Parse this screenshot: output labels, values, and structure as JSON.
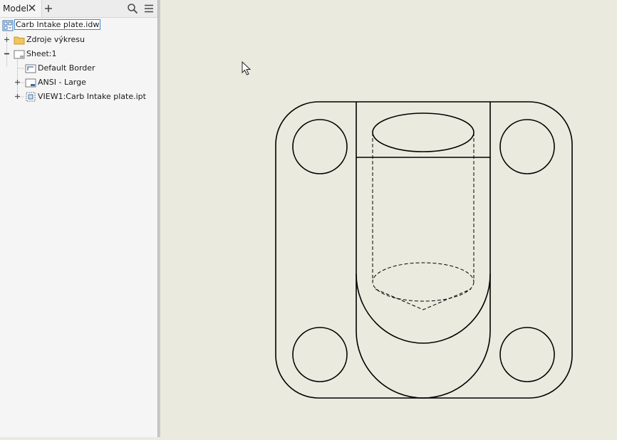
{
  "browser": {
    "tab_label": "Model",
    "tree": [
      {
        "label": "Carb Intake plate.idw",
        "icon": "drawing-document-icon",
        "expander": "none"
      },
      {
        "label": "Zdroje výkresu",
        "icon": "folder-icon",
        "expander": "plus"
      },
      {
        "label": "Sheet:1",
        "icon": "sheet-icon",
        "expander": "minus"
      },
      {
        "label": "Default Border",
        "icon": "border-icon",
        "expander": "none"
      },
      {
        "label": "ANSI - Large",
        "icon": "title-block-icon",
        "expander": "plus"
      },
      {
        "label": "VIEW1:Carb Intake plate.ipt",
        "icon": "drawing-view-icon",
        "expander": "plus"
      }
    ]
  },
  "canvas": {
    "background": "#ebeadf",
    "line_color": "#000000"
  }
}
